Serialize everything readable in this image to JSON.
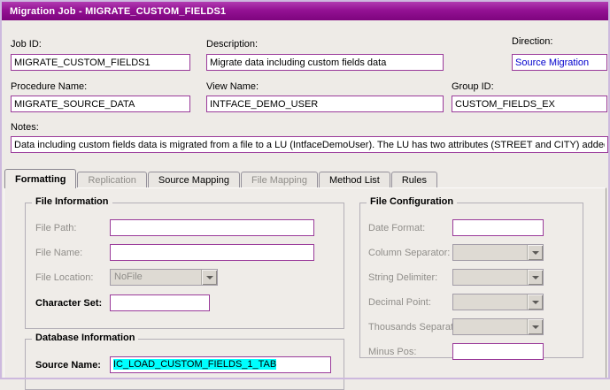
{
  "window": {
    "title": "Migration Job - MIGRATE_CUSTOM_FIELDS1"
  },
  "fields": {
    "job_id": {
      "label": "Job ID:",
      "value": "MIGRATE_CUSTOM_FIELDS1"
    },
    "description": {
      "label": "Description:",
      "value": "Migrate data including custom fields data"
    },
    "direction": {
      "label": "Direction:",
      "value": "Source Migration"
    },
    "procedure_name": {
      "label": "Procedure Name:",
      "value": "MIGRATE_SOURCE_DATA"
    },
    "view_name": {
      "label": "View Name:",
      "value": "INTFACE_DEMO_USER"
    },
    "group_id": {
      "label": "Group ID:",
      "value": "CUSTOM_FIELDS_EX"
    },
    "notes": {
      "label": "Notes:",
      "value": "Data including custom fields data is migrated from a file to a LU (IntfaceDemoUser). The LU has two attributes (STREET and CITY) added a"
    }
  },
  "tabs": [
    {
      "label": "Formatting",
      "active": true,
      "enabled": true
    },
    {
      "label": "Replication",
      "active": false,
      "enabled": false
    },
    {
      "label": "Source Mapping",
      "active": false,
      "enabled": true
    },
    {
      "label": "File Mapping",
      "active": false,
      "enabled": false
    },
    {
      "label": "Method List",
      "active": false,
      "enabled": true
    },
    {
      "label": "Rules",
      "active": false,
      "enabled": true
    }
  ],
  "file_information": {
    "title": "File Information",
    "file_path": {
      "label": "File Path:",
      "value": ""
    },
    "file_name": {
      "label": "File Name:",
      "value": ""
    },
    "file_location": {
      "label": "File Location:",
      "value": "NoFile"
    },
    "character_set": {
      "label": "Character Set:",
      "value": ""
    }
  },
  "file_configuration": {
    "title": "File Configuration",
    "date_format": {
      "label": "Date Format:",
      "value": ""
    },
    "column_separator": {
      "label": "Column Separator:",
      "value": ""
    },
    "string_delimiter": {
      "label": "String Delimiter:",
      "value": ""
    },
    "decimal_point": {
      "label": "Decimal Point:",
      "value": ""
    },
    "thousands_separator": {
      "label": "Thousands Separator",
      "value": ""
    },
    "minus_pos": {
      "label": "Minus Pos:",
      "value": ""
    }
  },
  "database_information": {
    "title": "Database Information",
    "source_name": {
      "label": "Source Name:",
      "value": "IC_LOAD_CUSTOM_FIELDS_1_TAB"
    }
  },
  "colors": {
    "titlebar_purple": "#941294",
    "field_border_purple": "#9A3A9A",
    "selection_highlight_cyan": "#00FFFF",
    "direction_text_blue": "#0000CD"
  }
}
